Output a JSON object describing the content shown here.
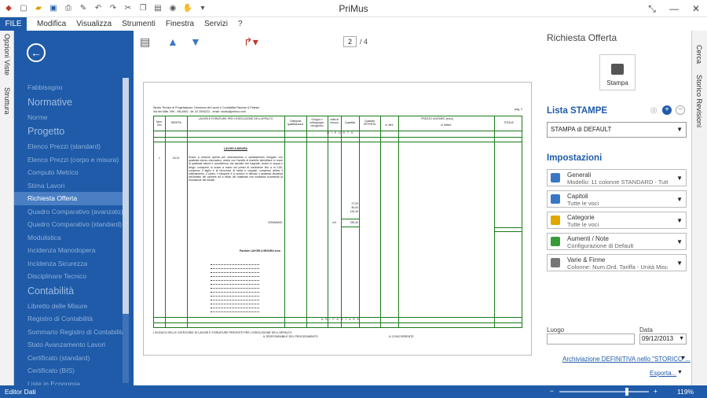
{
  "window": {
    "title": "PriMus",
    "controls": [
      "restore",
      "minimize",
      "close"
    ]
  },
  "quick_access": [
    "logo-icon",
    "new-icon",
    "open-icon",
    "save-icon",
    "print-icon",
    "tools-icon",
    "undo-icon",
    "redo-icon",
    "cut-icon",
    "copy-icon",
    "paste-icon",
    "format-icon",
    "help-icon",
    "dropdown-icon"
  ],
  "menu": {
    "file": "FILE",
    "items": [
      "Modifica",
      "Visualizza",
      "Strumenti",
      "Finestra",
      "Servizi",
      "?"
    ]
  },
  "left_tabs": [
    "Opzioni Viste",
    "Struttura"
  ],
  "nav": {
    "items": [
      {
        "label": "Fabbisogno",
        "type": "item"
      },
      {
        "label": "Normative",
        "type": "head"
      },
      {
        "label": "Norme",
        "type": "item"
      },
      {
        "label": "Progetto",
        "type": "head"
      },
      {
        "label": "Elenco Prezzi (standard)",
        "type": "item"
      },
      {
        "label": "Elenco Prezzi (corpo e misura)",
        "type": "item"
      },
      {
        "label": "Computo Metrico",
        "type": "item"
      },
      {
        "label": "Stima Lavori",
        "type": "item"
      },
      {
        "label": "Richiesta Offerta",
        "type": "active"
      },
      {
        "label": "Quadro Comparativo (avanzato)",
        "type": "item"
      },
      {
        "label": "Quadro Comparativo (standard)",
        "type": "item"
      },
      {
        "label": "Modulistica",
        "type": "item"
      },
      {
        "label": "Incidenza Manodopera",
        "type": "item"
      },
      {
        "label": "Incidenza Sicurezza",
        "type": "item"
      },
      {
        "label": "Disciplinare Tecnico",
        "type": "item"
      },
      {
        "label": "Contabilità",
        "type": "head"
      },
      {
        "label": "Libretto delle Misure",
        "type": "item"
      },
      {
        "label": "Registro di Contabilità",
        "type": "item"
      },
      {
        "label": "Sommario Registro di Contabilità",
        "type": "item"
      },
      {
        "label": "Stato Avanzamento Lavori",
        "type": "item"
      },
      {
        "label": "Certificato (standard)",
        "type": "item"
      },
      {
        "label": "Certificato (BIS)",
        "type": "item"
      },
      {
        "label": "Liste in Economia",
        "type": "item"
      }
    ]
  },
  "toolbar": {
    "page_current": "2",
    "page_total": "/ 4"
  },
  "document": {
    "header_line1": "Studio Tecnico di Progettazione, Direzione dei Lavori e Contabilità Paluese & Palessi",
    "header_line2": "Via dei Mille, 999 - MILANO - tel. 02 2544222 - email: studio@primus.com",
    "page": "pag. 2",
    "col_num": "Num. Ord.",
    "col_tariffa": "TARIFFA",
    "col_desc": "LAVORI E FORNITURE PER L'ESECUZIONE DELL'APPALTO",
    "col_cat": "Categoria qualificazione",
    "col_gruppo": "Gruppo o sottogruppo omogeneo",
    "col_unita": "unità di misura",
    "col_quantita": "Quantità",
    "col_quantita_offerta": "Quantità OFFERTA",
    "col_prezzo": "PREZZO UNITARIO (euro)",
    "col_in_cifre": "in cifre",
    "col_in_lettere": "in lettere",
    "col_totale": "TOTALE",
    "riporto": "R I P O R T O",
    "row_num": "1",
    "row_tariffa": "2A.01",
    "row_title": "LAVORI A MISURA",
    "row_desc": "Scavo a sezione aperta per sbancamento e splateamento eseguito con qualsiasi mezzo meccanico, anche con l'ausilio di martello demolitore in rocce di qualsiasi natura e consistenza, sia asciutte che bagnate, anche in acqua o fango, compreso lo scavo a mano nei pressi di condutture fino a m 0,50, compreso il taglio e la rimozione di radici e ceppaie, compreso altresì il sollevamento, il carico, il trasporto e lo scarico in rilevato o qualsiasi discarica nell'ambito del cantiere ed a rifiuto del materiale che risultasse eccedente la formazione dei rilevati.",
    "row_vals": [
      "27,00",
      "80,00",
      "132,40"
    ],
    "row_sommano": "SOMMANO...",
    "row_um": "m3",
    "row_total": "239,40",
    "parziale": "Parziale LAVORI A MISURA euro",
    "riportare": "A  R I P O R T A R E",
    "foot1": "L'ELENCO DELLE CATEGORIE DI LAVORI E FORNITURE PREVISTE PER L'ESECUZIONE DELL'APPALTO",
    "foot2": "IL RESPONSABILE DEL PROCEDIMENTO",
    "foot3": "IL CONCORRENTE"
  },
  "panel": {
    "title": "Richiesta Offerta",
    "stampa": "Stampa",
    "lista_title": "Lista STAMPE",
    "lista_value": "STAMPA di DEFAULT",
    "impostazioni": "Impostazioni",
    "settings": [
      {
        "title": "Generali",
        "sub": "Modello: 11 colonne STANDARD - Tutte le ...",
        "icon": "table-icon",
        "color": "#3b78c4"
      },
      {
        "title": "Capitoli",
        "sub": "Tutte le voci",
        "icon": "chapters-icon",
        "color": "#3b78c4"
      },
      {
        "title": "Categorie",
        "sub": "Tutte le voci",
        "icon": "folder-icon",
        "color": "#e0a800"
      },
      {
        "title": "Aumenti / Note",
        "sub": "Configurazione di Default",
        "icon": "notes-icon",
        "color": "#3a9a3a"
      },
      {
        "title": "Varie & Firme",
        "sub": "Colonne: Num.Ord. Tariffa - Unità Misura...",
        "icon": "pen-icon",
        "color": "#777"
      }
    ],
    "luogo_label": "Luogo",
    "luogo_value": "",
    "data_label": "Data",
    "data_value": "09/12/2013",
    "archiviazione": "Archiviazione DEFINITIVA nello \"STORICO\"...",
    "esporta": "Esporta..."
  },
  "right_tabs": [
    "Cerca",
    "Storico Revisioni"
  ],
  "status": {
    "left": "Editor Dati",
    "zoom": "119%"
  }
}
